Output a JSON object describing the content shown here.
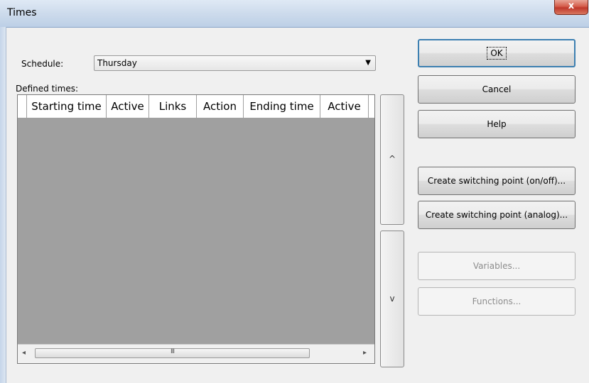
{
  "window": {
    "title": "Times",
    "close_glyph": "x"
  },
  "schedule": {
    "label": "Schedule:",
    "value": "Thursday",
    "arrow": "▼"
  },
  "defined_times": {
    "label": "Defined times:",
    "columns": [
      "Starting time",
      "Active",
      "Links",
      "Action",
      "Ending time",
      "Active"
    ],
    "rows": [],
    "scroll_left": "◂",
    "scroll_right": "▸",
    "scroll_grip": "III"
  },
  "move_buttons": {
    "up": "^",
    "down": "v"
  },
  "buttons": {
    "ok": "OK",
    "cancel": "Cancel",
    "help": "Help",
    "create_onoff": "Create switching point (on/off)...",
    "create_analog": "Create switching point (analog)...",
    "variables": "Variables...",
    "functions": "Functions..."
  }
}
